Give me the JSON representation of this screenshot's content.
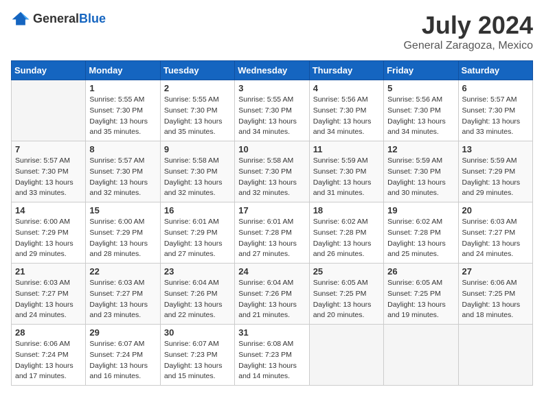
{
  "logo": {
    "general": "General",
    "blue": "Blue"
  },
  "header": {
    "month": "July 2024",
    "location": "General Zaragoza, Mexico"
  },
  "weekdays": [
    "Sunday",
    "Monday",
    "Tuesday",
    "Wednesday",
    "Thursday",
    "Friday",
    "Saturday"
  ],
  "weeks": [
    [
      {
        "day": null
      },
      {
        "day": 1,
        "sunrise": "5:55 AM",
        "sunset": "7:30 PM",
        "daylight": "13 hours and 35 minutes."
      },
      {
        "day": 2,
        "sunrise": "5:55 AM",
        "sunset": "7:30 PM",
        "daylight": "13 hours and 35 minutes."
      },
      {
        "day": 3,
        "sunrise": "5:55 AM",
        "sunset": "7:30 PM",
        "daylight": "13 hours and 34 minutes."
      },
      {
        "day": 4,
        "sunrise": "5:56 AM",
        "sunset": "7:30 PM",
        "daylight": "13 hours and 34 minutes."
      },
      {
        "day": 5,
        "sunrise": "5:56 AM",
        "sunset": "7:30 PM",
        "daylight": "13 hours and 34 minutes."
      },
      {
        "day": 6,
        "sunrise": "5:57 AM",
        "sunset": "7:30 PM",
        "daylight": "13 hours and 33 minutes."
      }
    ],
    [
      {
        "day": 7,
        "sunrise": "5:57 AM",
        "sunset": "7:30 PM",
        "daylight": "13 hours and 33 minutes."
      },
      {
        "day": 8,
        "sunrise": "5:57 AM",
        "sunset": "7:30 PM",
        "daylight": "13 hours and 32 minutes."
      },
      {
        "day": 9,
        "sunrise": "5:58 AM",
        "sunset": "7:30 PM",
        "daylight": "13 hours and 32 minutes."
      },
      {
        "day": 10,
        "sunrise": "5:58 AM",
        "sunset": "7:30 PM",
        "daylight": "13 hours and 32 minutes."
      },
      {
        "day": 11,
        "sunrise": "5:59 AM",
        "sunset": "7:30 PM",
        "daylight": "13 hours and 31 minutes."
      },
      {
        "day": 12,
        "sunrise": "5:59 AM",
        "sunset": "7:30 PM",
        "daylight": "13 hours and 30 minutes."
      },
      {
        "day": 13,
        "sunrise": "5:59 AM",
        "sunset": "7:29 PM",
        "daylight": "13 hours and 29 minutes."
      }
    ],
    [
      {
        "day": 14,
        "sunrise": "6:00 AM",
        "sunset": "7:29 PM",
        "daylight": "13 hours and 29 minutes."
      },
      {
        "day": 15,
        "sunrise": "6:00 AM",
        "sunset": "7:29 PM",
        "daylight": "13 hours and 28 minutes."
      },
      {
        "day": 16,
        "sunrise": "6:01 AM",
        "sunset": "7:29 PM",
        "daylight": "13 hours and 27 minutes."
      },
      {
        "day": 17,
        "sunrise": "6:01 AM",
        "sunset": "7:28 PM",
        "daylight": "13 hours and 27 minutes."
      },
      {
        "day": 18,
        "sunrise": "6:02 AM",
        "sunset": "7:28 PM",
        "daylight": "13 hours and 26 minutes."
      },
      {
        "day": 19,
        "sunrise": "6:02 AM",
        "sunset": "7:28 PM",
        "daylight": "13 hours and 25 minutes."
      },
      {
        "day": 20,
        "sunrise": "6:03 AM",
        "sunset": "7:27 PM",
        "daylight": "13 hours and 24 minutes."
      }
    ],
    [
      {
        "day": 21,
        "sunrise": "6:03 AM",
        "sunset": "7:27 PM",
        "daylight": "13 hours and 24 minutes."
      },
      {
        "day": 22,
        "sunrise": "6:03 AM",
        "sunset": "7:27 PM",
        "daylight": "13 hours and 23 minutes."
      },
      {
        "day": 23,
        "sunrise": "6:04 AM",
        "sunset": "7:26 PM",
        "daylight": "13 hours and 22 minutes."
      },
      {
        "day": 24,
        "sunrise": "6:04 AM",
        "sunset": "7:26 PM",
        "daylight": "13 hours and 21 minutes."
      },
      {
        "day": 25,
        "sunrise": "6:05 AM",
        "sunset": "7:25 PM",
        "daylight": "13 hours and 20 minutes."
      },
      {
        "day": 26,
        "sunrise": "6:05 AM",
        "sunset": "7:25 PM",
        "daylight": "13 hours and 19 minutes."
      },
      {
        "day": 27,
        "sunrise": "6:06 AM",
        "sunset": "7:25 PM",
        "daylight": "13 hours and 18 minutes."
      }
    ],
    [
      {
        "day": 28,
        "sunrise": "6:06 AM",
        "sunset": "7:24 PM",
        "daylight": "13 hours and 17 minutes."
      },
      {
        "day": 29,
        "sunrise": "6:07 AM",
        "sunset": "7:24 PM",
        "daylight": "13 hours and 16 minutes."
      },
      {
        "day": 30,
        "sunrise": "6:07 AM",
        "sunset": "7:23 PM",
        "daylight": "13 hours and 15 minutes."
      },
      {
        "day": 31,
        "sunrise": "6:08 AM",
        "sunset": "7:23 PM",
        "daylight": "13 hours and 14 minutes."
      },
      {
        "day": null
      },
      {
        "day": null
      },
      {
        "day": null
      }
    ]
  ]
}
